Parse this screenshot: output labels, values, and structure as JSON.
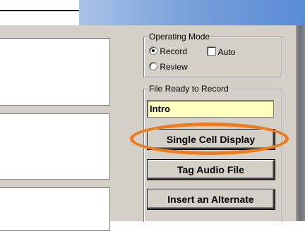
{
  "operating_mode": {
    "legend": "Operating Mode",
    "record_label": "Record",
    "auto_label": "Auto",
    "review_label": "Review",
    "selected": "Record",
    "auto_checked": false
  },
  "file_ready": {
    "legend": "File Ready to Record",
    "value": "Intro"
  },
  "buttons": {
    "single_cell": "Single Cell Display",
    "tag_audio": "Tag Audio File",
    "insert_alternate": "Insert an Alternate"
  },
  "annotation_color": "#f07a1e"
}
